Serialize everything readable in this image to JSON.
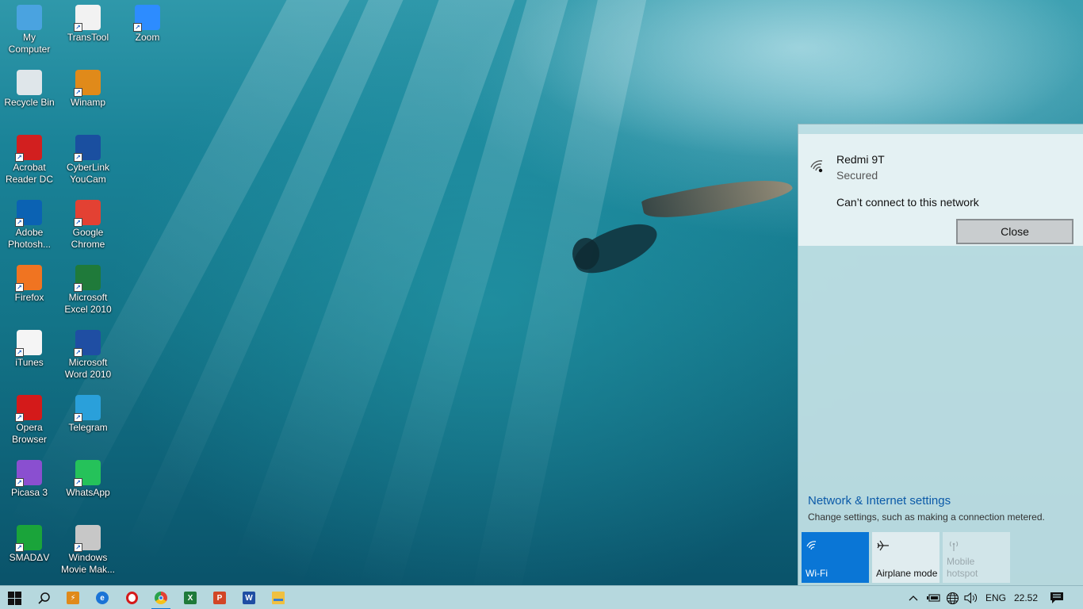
{
  "desktop": {
    "icons": [
      {
        "label": "My\nComputer",
        "label_lines": [
          "My",
          "Computer"
        ],
        "icon": "computer-icon",
        "color": "#4aa3e0"
      },
      {
        "label_lines": [
          "TransTool"
        ],
        "icon": "transtool-icon",
        "color": "#f2f2f2"
      },
      {
        "label_lines": [
          "Zoom"
        ],
        "icon": "zoom-icon",
        "color": "#2d8cff"
      },
      {
        "label_lines": [
          "Recycle Bin"
        ],
        "icon": "recycle-bin-icon",
        "color": "#dfe6ea"
      },
      {
        "label_lines": [
          "Winamp"
        ],
        "icon": "winamp-icon",
        "color": "#e08a1a"
      },
      {
        "label_lines": [
          "Acrobat",
          "Reader DC"
        ],
        "icon": "acrobat-icon",
        "color": "#d21f1f"
      },
      {
        "label_lines": [
          "CyberLink",
          "YouCam"
        ],
        "icon": "youcam-icon",
        "color": "#1a4fa0"
      },
      {
        "label_lines": [
          "Adobe",
          "Photosh..."
        ],
        "icon": "photoshop-icon",
        "color": "#0b62b3"
      },
      {
        "label_lines": [
          "Google",
          "Chrome"
        ],
        "icon": "chrome-icon",
        "color": "#e34133"
      },
      {
        "label_lines": [
          "Firefox"
        ],
        "icon": "firefox-icon",
        "color": "#f07421"
      },
      {
        "label_lines": [
          "Microsoft",
          "Excel 2010"
        ],
        "icon": "excel-icon",
        "color": "#1f7a3a"
      },
      {
        "label_lines": [
          "iTunes"
        ],
        "icon": "itunes-icon",
        "color": "#f5f5f5"
      },
      {
        "label_lines": [
          "Microsoft",
          "Word 2010"
        ],
        "icon": "word-icon",
        "color": "#1f4ea3"
      },
      {
        "label_lines": [
          "Opera",
          "Browser"
        ],
        "icon": "opera-icon",
        "color": "#d41a1a"
      },
      {
        "label_lines": [
          "Telegram"
        ],
        "icon": "telegram-icon",
        "color": "#2aa0da"
      },
      {
        "label_lines": [
          "Picasa 3"
        ],
        "icon": "picasa-icon",
        "color": "#8a4fd0"
      },
      {
        "label_lines": [
          "WhatsApp"
        ],
        "icon": "whatsapp-icon",
        "color": "#25c25a"
      },
      {
        "label_lines": [
          "SMADΔV"
        ],
        "icon": "smadav-icon",
        "color": "#1aa43a"
      },
      {
        "label_lines": [
          "Windows",
          "Movie Mak..."
        ],
        "icon": "movie-maker-icon",
        "color": "#c7c7c7"
      }
    ]
  },
  "network_flyout": {
    "network_name": "Redmi 9T",
    "network_status": "Secured",
    "error_message": "Can’t connect to this network",
    "close_label": "Close",
    "settings_link": "Network & Internet settings",
    "settings_description": "Change settings, such as making a connection metered.",
    "quick_actions": [
      {
        "label": "Wi-Fi",
        "icon": "wifi-icon",
        "state": "on"
      },
      {
        "label": "Airplane mode",
        "icon": "airplane-icon",
        "state": "off"
      },
      {
        "label": "Mobile\nhotspot",
        "label_lines": [
          "Mobile",
          "hotspot"
        ],
        "icon": "hotspot-icon",
        "state": "disabled"
      }
    ]
  },
  "taskbar": {
    "pinned": [
      {
        "name": "start",
        "icon": "windows-start-icon"
      },
      {
        "name": "search",
        "icon": "search-icon"
      },
      {
        "name": "winamp",
        "icon": "winamp-icon"
      },
      {
        "name": "edge",
        "icon": "edge-icon"
      },
      {
        "name": "opera",
        "icon": "opera-icon"
      },
      {
        "name": "chrome",
        "icon": "chrome-icon",
        "active": true
      },
      {
        "name": "excel",
        "icon": "excel-icon"
      },
      {
        "name": "powerpoint",
        "icon": "powerpoint-icon"
      },
      {
        "name": "word",
        "icon": "word-icon"
      },
      {
        "name": "file-explorer",
        "icon": "file-explorer-icon"
      }
    ],
    "tray": {
      "language": "ENG",
      "time": "22.52"
    }
  },
  "colors": {
    "accent": "#0a76d6",
    "link": "#0b5aa8",
    "taskbar": "#b6d8de"
  }
}
